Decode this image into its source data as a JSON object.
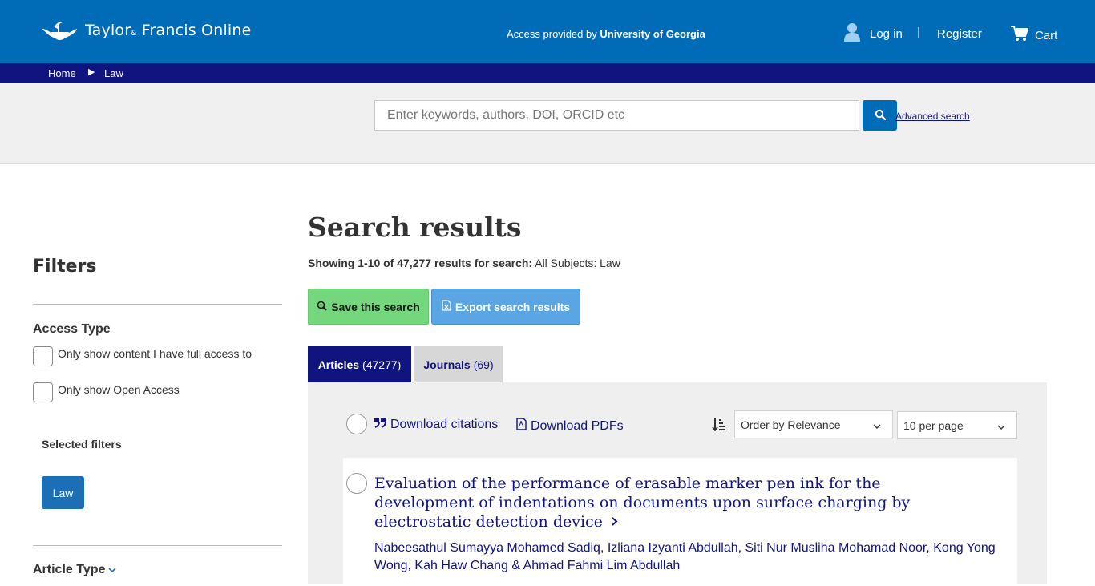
{
  "header": {
    "logo_text": "Taylor",
    "logo_amp": "&",
    "logo_text2": "Francis Online",
    "access_prefix": "Access provided by",
    "access_org": "University of Georgia",
    "login_label": "Log in",
    "separator": "|",
    "register_label": "Register",
    "cart_label": "Cart"
  },
  "breadcrumb": {
    "home": "Home",
    "arrow": "▶",
    "current": "Law"
  },
  "search": {
    "placeholder": "Enter keywords, authors, DOI, ORCID etc",
    "advanced_label": "Advanced search"
  },
  "filters": {
    "title": "Filters",
    "access_type_heading": "Access Type",
    "full_access_label": "Only show content I have full access to",
    "open_access_label": "Only show Open Access",
    "selected_filters_label": "Selected filters",
    "selected_chip": "Law",
    "article_type_heading": "Article Type"
  },
  "results": {
    "title": "Search results",
    "showing_bold": "Showing 1-10 of 47,277 results for search:",
    "showing_rest": " All Subjects: Law",
    "save_label": "Save this search",
    "export_label": "Export search results",
    "tabs": [
      {
        "label": "Articles",
        "count": "(47277)"
      },
      {
        "label": "Journals",
        "count": "(69)"
      }
    ],
    "download_citations": "Download citations",
    "download_pdfs": "Download PDFs",
    "order_by": "Order by Relevance",
    "per_page": "10 per page"
  },
  "articles": [
    {
      "title": "Evaluation of the performance of erasable marker pen ink for the development of indentations on documents upon surface charging by electrostatic detection device",
      "authors": "Nabeesathul Sumayya Mohamed Sadiq, Izliana Izyanti Abdullah, Siti Nur Musliha Mohamad Noor, Kong Yong Wong, Kah Haw Chang & Ahmad Fahmi Lim Abdullah"
    }
  ],
  "colors": {
    "header_blue": "#006cb7",
    "navy": "#10147e",
    "save_green": "#74d67d",
    "export_blue": "#5aa5e3"
  }
}
